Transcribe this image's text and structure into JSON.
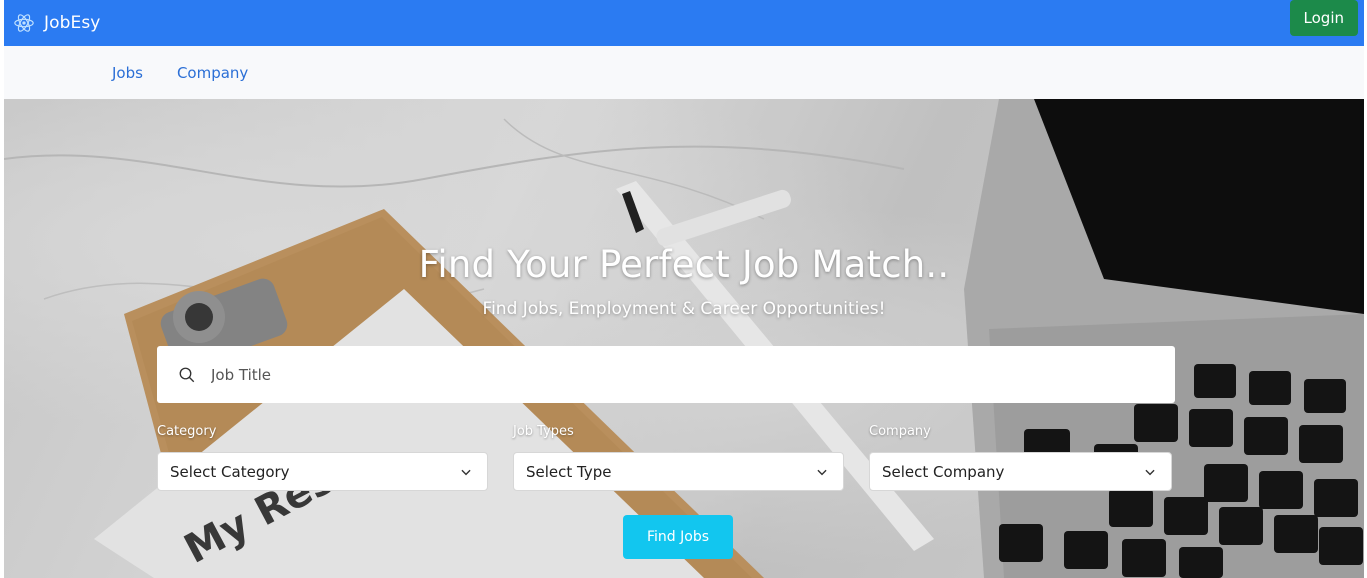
{
  "header": {
    "brand": "JobEsy",
    "login_label": "Login"
  },
  "nav": {
    "jobs": "Jobs",
    "company": "Company"
  },
  "hero": {
    "title": "Find Your Perfect Job Match..",
    "subtitle": "Find Jobs, Employment & Career Opportunities!",
    "clipboard_text": "My Resu"
  },
  "search": {
    "placeholder": "Job Title",
    "value": ""
  },
  "filters": {
    "category": {
      "label": "Category",
      "value": "Select Category"
    },
    "job_types": {
      "label": "Job Types",
      "value": "Select Type"
    },
    "company": {
      "label": "Company",
      "value": "Select Company"
    }
  },
  "actions": {
    "find_label": "Find Jobs"
  },
  "colors": {
    "topbar": "#2b7bf2",
    "login": "#1c8a4a",
    "nav_link": "#2b6fd6",
    "find_button": "#12c6ef"
  },
  "icons": {
    "brand": "react-atom-icon",
    "search": "search-icon",
    "dropdown": "chevron-down-icon"
  }
}
